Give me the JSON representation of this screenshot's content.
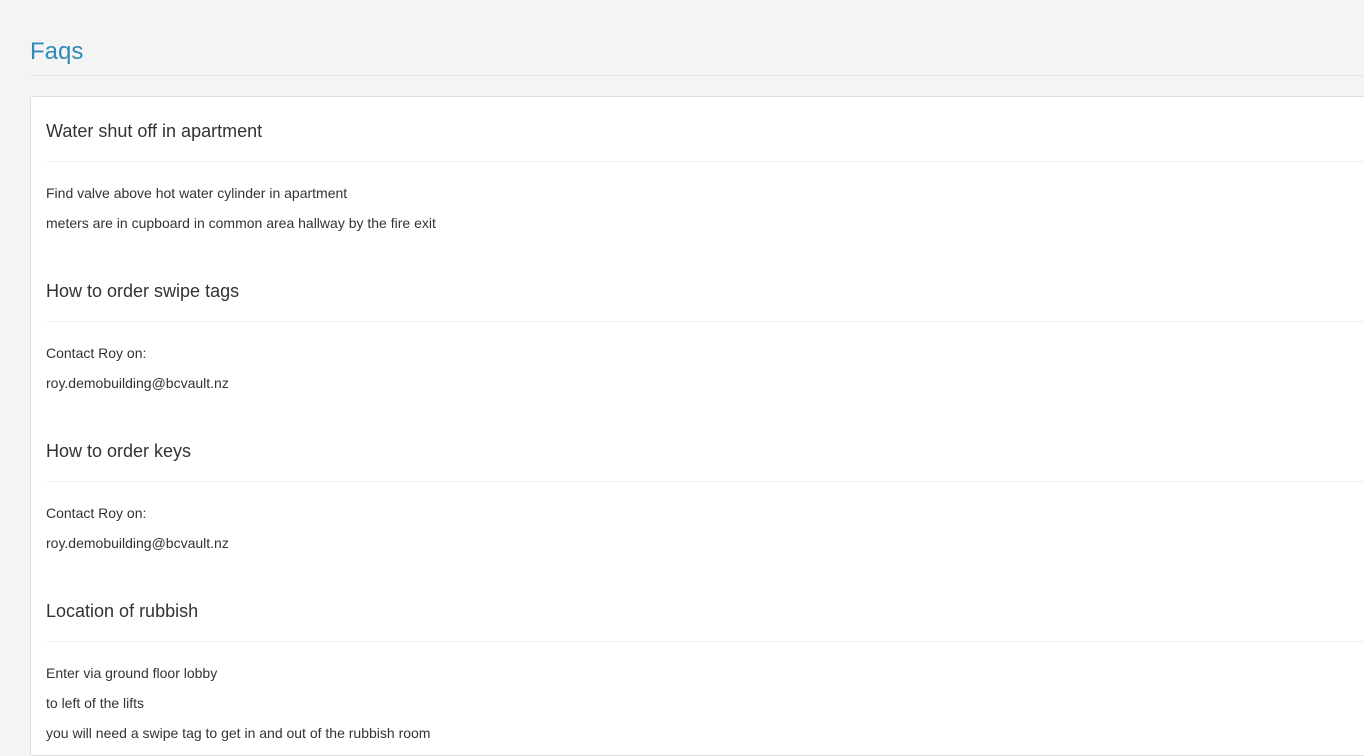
{
  "page": {
    "title": "Faqs"
  },
  "faqs": [
    {
      "question": "Water shut off in apartment",
      "answer_lines": [
        "Find valve above hot water cylinder in apartment",
        "meters are in cupboard in common area hallway by the fire exit"
      ]
    },
    {
      "question": "How to order swipe tags",
      "answer_lines": [
        "Contact Roy on:",
        "roy.demobuilding@bcvault.nz"
      ]
    },
    {
      "question": "How to order keys",
      "answer_lines": [
        "Contact Roy on:",
        "roy.demobuilding@bcvault.nz"
      ]
    },
    {
      "question": "Location of rubbish",
      "answer_lines": [
        "Enter via ground floor lobby",
        "to left of the lifts",
        "you will need a swipe tag to get in and out of the rubbish room"
      ]
    }
  ],
  "colors": {
    "title": "#2f8ab7",
    "background": "#f4f4f4",
    "panel": "#ffffff",
    "text": "#333333"
  }
}
